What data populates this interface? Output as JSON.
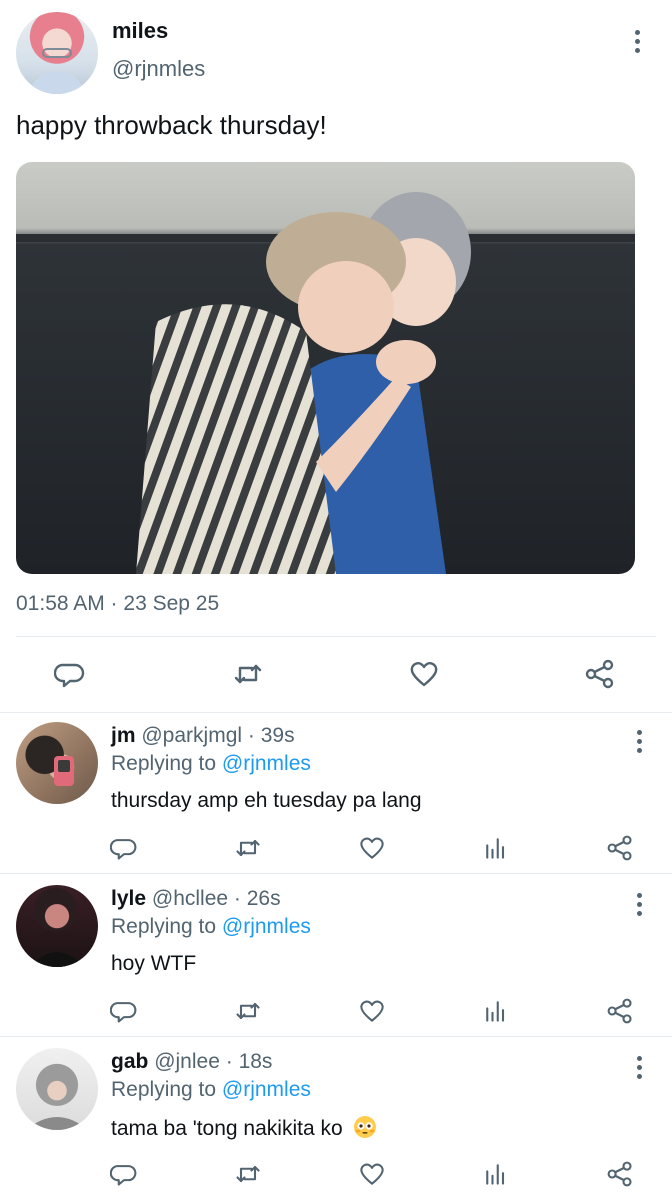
{
  "colors": {
    "text": "#0f1419",
    "muted": "#536471",
    "link": "#1d9bf0",
    "divider": "#e6ecf0"
  },
  "main_tweet": {
    "name": "miles",
    "handle": "@rjnmles",
    "text": "happy throwback thursday!",
    "timestamp": "01:58 AM · 23 Sep 25",
    "actions": [
      "reply-icon",
      "retweet-icon",
      "like-icon",
      "share-icon"
    ]
  },
  "replies": [
    {
      "name": "jm",
      "handle": "@parkjmgl",
      "age": "39s",
      "replying_prefix": "Replying to ",
      "replying_to": "@rjnmles",
      "text": "thursday amp eh tuesday pa lang"
    },
    {
      "name": "lyle",
      "handle": "@hcllee",
      "age": "26s",
      "replying_prefix": "Replying to ",
      "replying_to": "@rjnmles",
      "text": "hoy WTF"
    },
    {
      "name": "gab",
      "handle": "@jnlee",
      "age": "18s",
      "replying_prefix": "Replying to ",
      "replying_to": "@rjnmles",
      "text": "tama ba 'tong nakikita ko",
      "emoji": "flushed-face-emoji"
    }
  ],
  "reply_actions": [
    "reply-icon",
    "retweet-icon",
    "like-icon",
    "analytics-icon",
    "share-icon"
  ]
}
